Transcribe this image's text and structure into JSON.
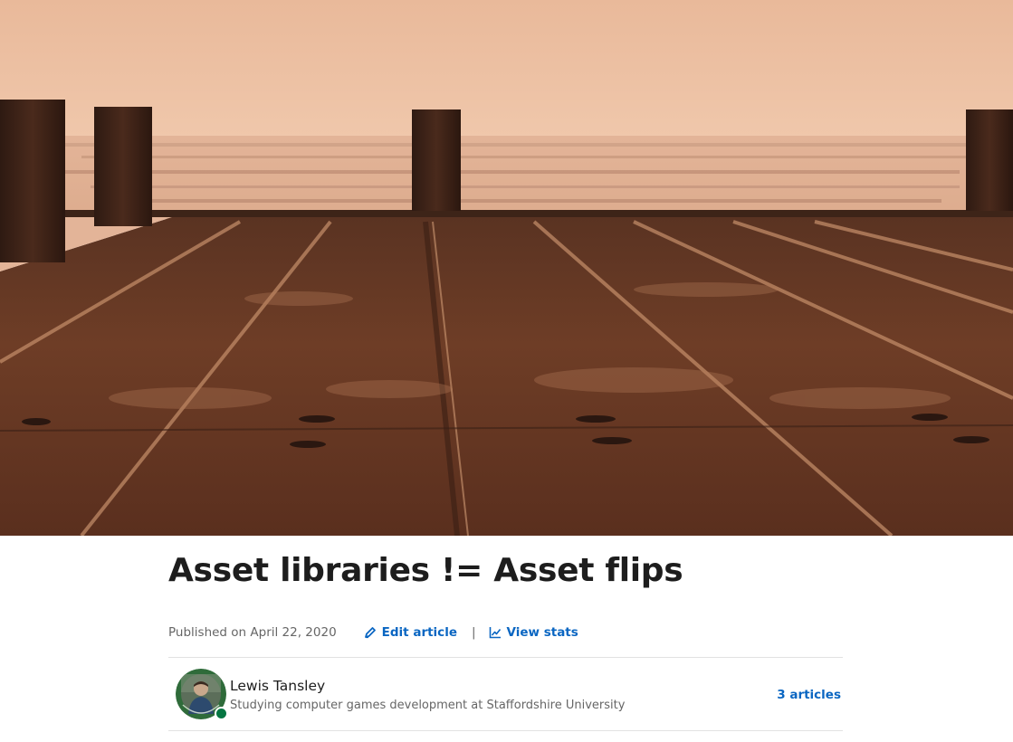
{
  "article": {
    "title": "Asset libraries != Asset flips",
    "published": "Published on April 22, 2020"
  },
  "actions": {
    "edit_label": "Edit article",
    "separator": "|",
    "stats_label": "View stats"
  },
  "author": {
    "name": "Lewis Tansley",
    "headline": "Studying computer games development at Staffordshire University",
    "articles_label": "3 articles",
    "online": true
  },
  "colors": {
    "link": "#0a66c2",
    "online": "#057642"
  },
  "icons": {
    "edit": "pencil-icon",
    "stats": "line-chart-icon"
  }
}
